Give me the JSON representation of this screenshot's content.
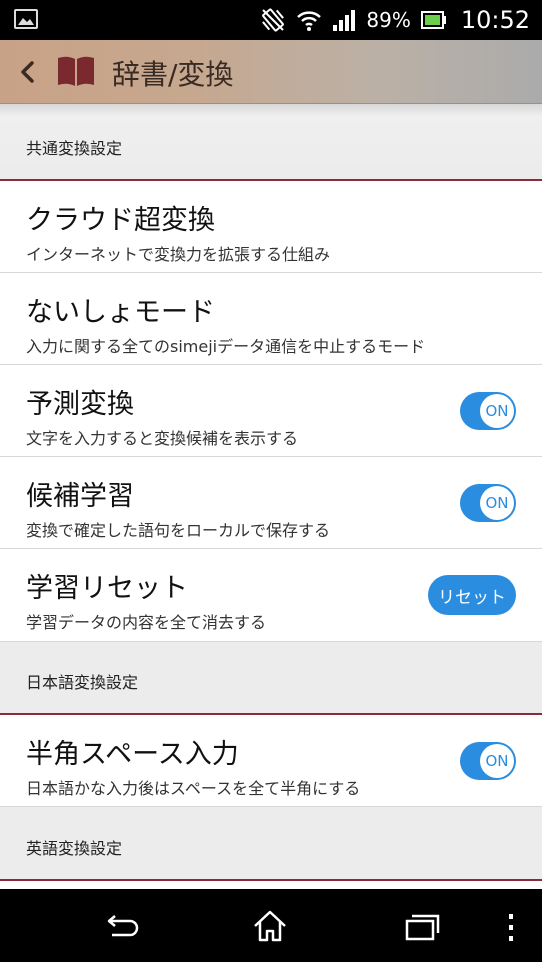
{
  "status_bar": {
    "battery_percent": "89%",
    "time": "10:52",
    "icons": [
      "gallery-icon",
      "vibrate-icon",
      "wifi-icon",
      "signal-icon",
      "battery-icon"
    ]
  },
  "app_bar": {
    "title": "辞書/変換",
    "icons": [
      "back-icon",
      "book-icon"
    ]
  },
  "sections": {
    "common": {
      "label": "共通変換設定"
    },
    "japanese": {
      "label": "日本語変換設定"
    },
    "english": {
      "label": "英語変換設定"
    }
  },
  "items": {
    "cloud": {
      "title": "クラウド超変換",
      "subtitle": "インターネットで変換力を拡張する仕組み"
    },
    "secret": {
      "title": "ないしょモード",
      "subtitle": "入力に関する全てのsimejiデータ通信を中止するモード"
    },
    "prediction": {
      "title": "予測変換",
      "subtitle": "文字を入力すると変換候補を表示する",
      "toggle": "ON",
      "enabled": true
    },
    "learning": {
      "title": "候補学習",
      "subtitle": "変換で確定した語句をローカルで保存する",
      "toggle": "ON",
      "enabled": true
    },
    "reset": {
      "title": "学習リセット",
      "subtitle": "学習データの内容を全て消去する",
      "button": "リセット"
    },
    "halfwidth_space": {
      "title": "半角スペース入力",
      "subtitle": "日本語かな入力後はスペースを全て半角にする",
      "toggle": "ON",
      "enabled": true
    }
  },
  "nav_bar": {
    "icons": [
      "back-nav-icon",
      "home-icon",
      "recents-icon",
      "overflow-menu-icon"
    ]
  },
  "colors": {
    "accent": "#2a8de0",
    "section_divider": "#8a2a3a",
    "app_bar_start": "#c8a286",
    "app_bar_end": "#ababab",
    "book_icon": "#7a2a2e"
  }
}
